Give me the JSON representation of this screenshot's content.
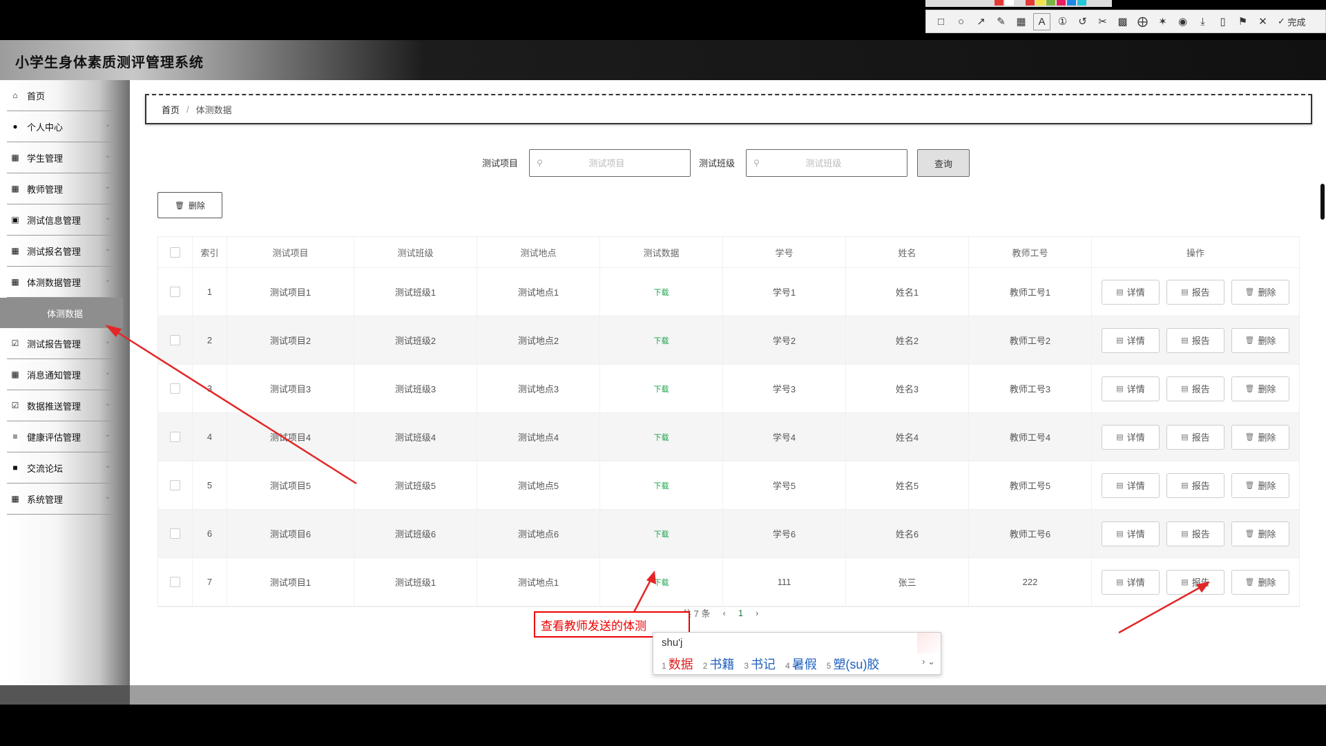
{
  "app": {
    "title": "小学生身体素质测评管理系统"
  },
  "screenshot_tool": {
    "done_label": "完成",
    "palette": [
      "#e53935",
      "#ffffff",
      "#dddddd",
      "#e53935",
      "#f4e04d",
      "#7cb342",
      "#e91e63",
      "#1e88e5",
      "#26c6da"
    ]
  },
  "sidebar": {
    "items": [
      {
        "label": "首页",
        "icon": "home-icon",
        "chev": false
      },
      {
        "label": "个人中心",
        "icon": "user-icon",
        "chev": true
      },
      {
        "label": "学生管理",
        "icon": "grid-icon",
        "chev": true
      },
      {
        "label": "教师管理",
        "icon": "grid-icon",
        "chev": true
      },
      {
        "label": "测试信息管理",
        "icon": "monitor-icon",
        "chev": true
      },
      {
        "label": "测试报名管理",
        "icon": "grid-icon",
        "chev": true
      },
      {
        "label": "体测数据管理",
        "icon": "grid-icon",
        "chev": true
      }
    ],
    "sub_item": "体测数据",
    "items2": [
      {
        "label": "测试报告管理",
        "icon": "check-icon",
        "chev": true
      },
      {
        "label": "消息通知管理",
        "icon": "grid-icon",
        "chev": true
      },
      {
        "label": "数据推送管理",
        "icon": "check-icon",
        "chev": true
      },
      {
        "label": "健康评估管理",
        "icon": "sliders-icon",
        "chev": true
      },
      {
        "label": "交流论坛",
        "icon": "chat-icon",
        "chev": true
      },
      {
        "label": "系统管理",
        "icon": "grid-icon",
        "chev": true
      }
    ]
  },
  "breadcrumb": {
    "home": "首页",
    "sep": "/",
    "current": "体测数据"
  },
  "search": {
    "label1": "测试项目",
    "placeholder1": "测试项目",
    "label2": "测试班级",
    "placeholder2": "测试班级",
    "query_label": "查询"
  },
  "toolbar": {
    "delete_label": "删除"
  },
  "table": {
    "headers": [
      "索引",
      "测试项目",
      "测试班级",
      "测试地点",
      "测试数据",
      "学号",
      "姓名",
      "教师工号",
      "操作"
    ],
    "download_label": "下载",
    "actions": [
      "详情",
      "报告",
      "删除"
    ],
    "rows": [
      [
        "1",
        "测试项目1",
        "测试班级1",
        "测试地点1",
        "学号1",
        "姓名1",
        "教师工号1"
      ],
      [
        "2",
        "测试项目2",
        "测试班级2",
        "测试地点2",
        "学号2",
        "姓名2",
        "教师工号2"
      ],
      [
        "3",
        "测试项目3",
        "测试班级3",
        "测试地点3",
        "学号3",
        "姓名3",
        "教师工号3"
      ],
      [
        "4",
        "测试项目4",
        "测试班级4",
        "测试地点4",
        "学号4",
        "姓名4",
        "教师工号4"
      ],
      [
        "5",
        "测试项目5",
        "测试班级5",
        "测试地点5",
        "学号5",
        "姓名5",
        "教师工号5"
      ],
      [
        "6",
        "测试项目6",
        "测试班级6",
        "测试地点6",
        "学号6",
        "姓名6",
        "教师工号6"
      ],
      [
        "7",
        "测试项目1",
        "测试班级1",
        "测试地点1",
        "111",
        "张三",
        "222"
      ]
    ]
  },
  "pagination": {
    "total": "共 7 条",
    "prev": "‹",
    "page": "1",
    "next": "›"
  },
  "annotation": {
    "text": "查看教师发送的体测"
  },
  "ime": {
    "composition": "shu'j",
    "candidates": [
      {
        "n": "1",
        "w": "数据"
      },
      {
        "n": "2",
        "w": "书籍"
      },
      {
        "n": "3",
        "w": "书记"
      },
      {
        "n": "4",
        "w": "暑假"
      },
      {
        "n": "5",
        "w": "塑(su)胶"
      }
    ],
    "more": "› ⌄"
  }
}
